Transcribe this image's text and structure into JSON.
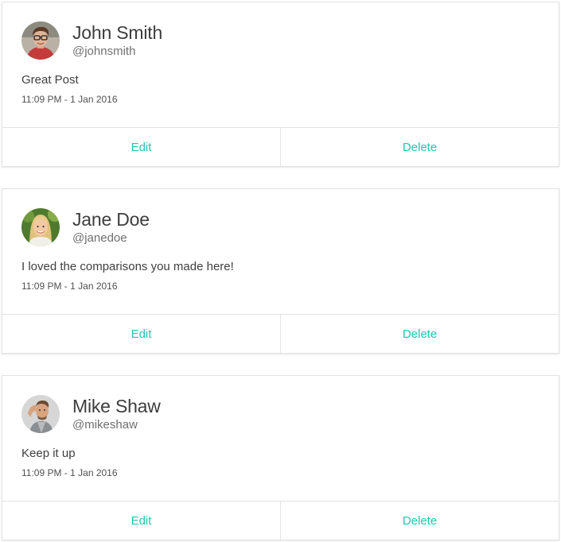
{
  "accent_color": "#1dc8b0",
  "comments": [
    {
      "avatar_icon": "avatar-john-smith",
      "name": "John Smith",
      "handle": "@johnsmith",
      "text": "Great Post",
      "timestamp": "11:09 PM - 1 Jan 2016",
      "edit_label": "Edit",
      "delete_label": "Delete"
    },
    {
      "avatar_icon": "avatar-jane-doe",
      "name": "Jane Doe",
      "handle": "@janedoe",
      "text": "I loved the comparisons you made here!",
      "timestamp": "11:09 PM - 1 Jan 2016",
      "edit_label": "Edit",
      "delete_label": "Delete"
    },
    {
      "avatar_icon": "avatar-mike-shaw",
      "name": "Mike Shaw",
      "handle": "@mikeshaw",
      "text": "Keep it up",
      "timestamp": "11:09 PM - 1 Jan 2016",
      "edit_label": "Edit",
      "delete_label": "Delete"
    }
  ]
}
